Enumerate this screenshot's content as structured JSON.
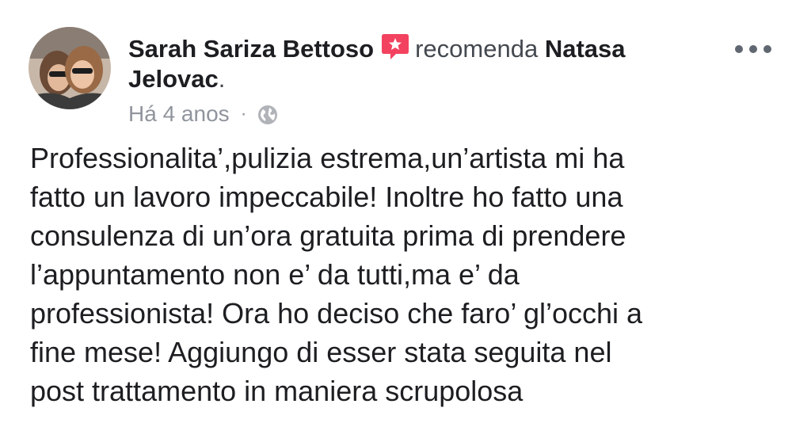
{
  "post": {
    "author_name": "Sarah Sariza Bettoso",
    "recommend_verb": "recomenda",
    "target_name": "Natasa Jelovac",
    "target_suffix": ".",
    "timestamp": "Há 4 anos",
    "separator": "·",
    "privacy_icon": "globe-icon",
    "recommendation_icon": "recommendation-star-icon",
    "more_icon": "more-options-icon",
    "text": "Professionalita’,pulizia estrema,un’artista mi ha\nfatto un lavoro impeccabile! Inoltre ho fatto una\nconsulenza di un’ora gratuita prima di prendere\nl’appuntamento non e’ da tutti,ma e’ da\nprofessionista! Ora ho deciso che faro’ gl’occhi a\nfine mese! Aggiungo di esser stata seguita nel\npost trattamento in maniera scrupolosa"
  },
  "colors": {
    "recommend_accent": "#f3425f",
    "meta_gray": "#90949c",
    "text_dark": "#1c1e21"
  }
}
